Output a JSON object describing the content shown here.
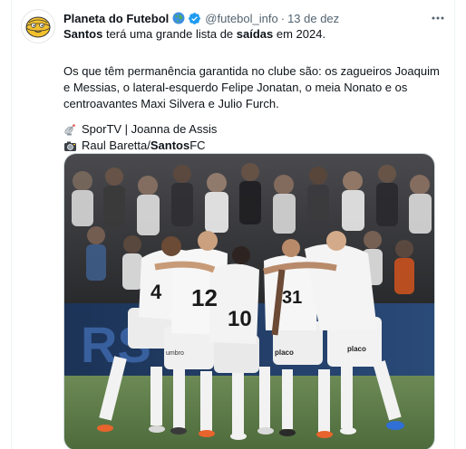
{
  "tweet": {
    "author_name": "Planeta do Futebol",
    "handle": "@futebol_info",
    "separator": "·",
    "date": "13 de dez",
    "line1": {
      "bold_start": "Santos",
      "middle": " terá uma grande lista de ",
      "bold_mid": "saídas",
      "end": " em 2024."
    },
    "paragraph2": "Os que têm permanência garantida no clube são: os zagueiros Joaquim e Messias, o lateral-esquerdo Felipe Jonatan, o meia Nonato e os centroavantes Maxi Silvera e Julio Furch.",
    "credit_source": "SporTV | Joanna de Assis",
    "credit_photo": {
      "prefix": "Raul Baretta/",
      "bold": "Santos",
      "suffix": " FC"
    },
    "icons": {
      "avatar": "planeta-do-futebol-ball-logo",
      "globe": "globe-emoji-icon",
      "verified": "gold-verified-badge-icon",
      "more": "more-options-icon",
      "credit_source": "satellite-antenna-icon",
      "credit_photo": "camera-icon"
    }
  },
  "photo": {
    "jersey_numbers": [
      "4",
      "12",
      "10",
      "31"
    ],
    "sponsor": "placo",
    "brand": "umbro",
    "stadium_banner": "RS",
    "colors": {
      "jersey": "#f2f2f2",
      "pitch": "#5d7a4a",
      "crowd": "#2e2f33",
      "banner": "#1c3357"
    }
  },
  "colors": {
    "text": "#0f1419",
    "muted": "#536471",
    "border": "#cfd9de",
    "verified": "#1d9bf0"
  }
}
